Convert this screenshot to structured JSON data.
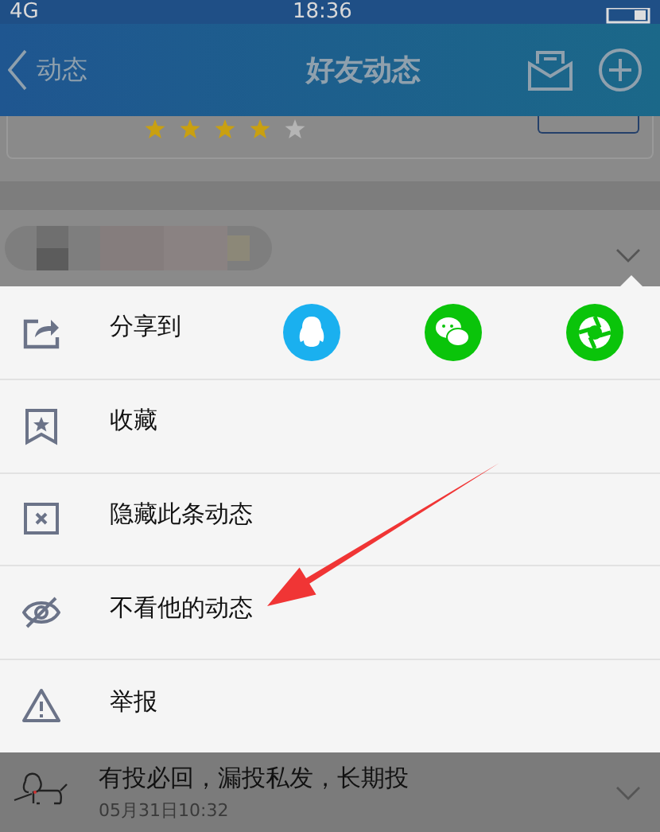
{
  "status_bar": {
    "network": "4G",
    "time": "18:36"
  },
  "header": {
    "back": "动态",
    "title": "好友动态"
  },
  "background_card": {
    "stars": 4
  },
  "menu": {
    "items": [
      {
        "kind": "share",
        "label": "分享到",
        "targets": [
          {
            "kind": "qq"
          },
          {
            "kind": "wechat"
          },
          {
            "kind": "moments"
          }
        ]
      },
      {
        "kind": "favorite",
        "label": "收藏"
      },
      {
        "kind": "hide",
        "label": "隐藏此条动态"
      },
      {
        "kind": "block",
        "label": "不看他的动态"
      },
      {
        "kind": "report",
        "label": "举报"
      }
    ]
  },
  "next_post": {
    "text": "有投必回，漏投私发，长期投",
    "time": "05月31日10:32"
  }
}
